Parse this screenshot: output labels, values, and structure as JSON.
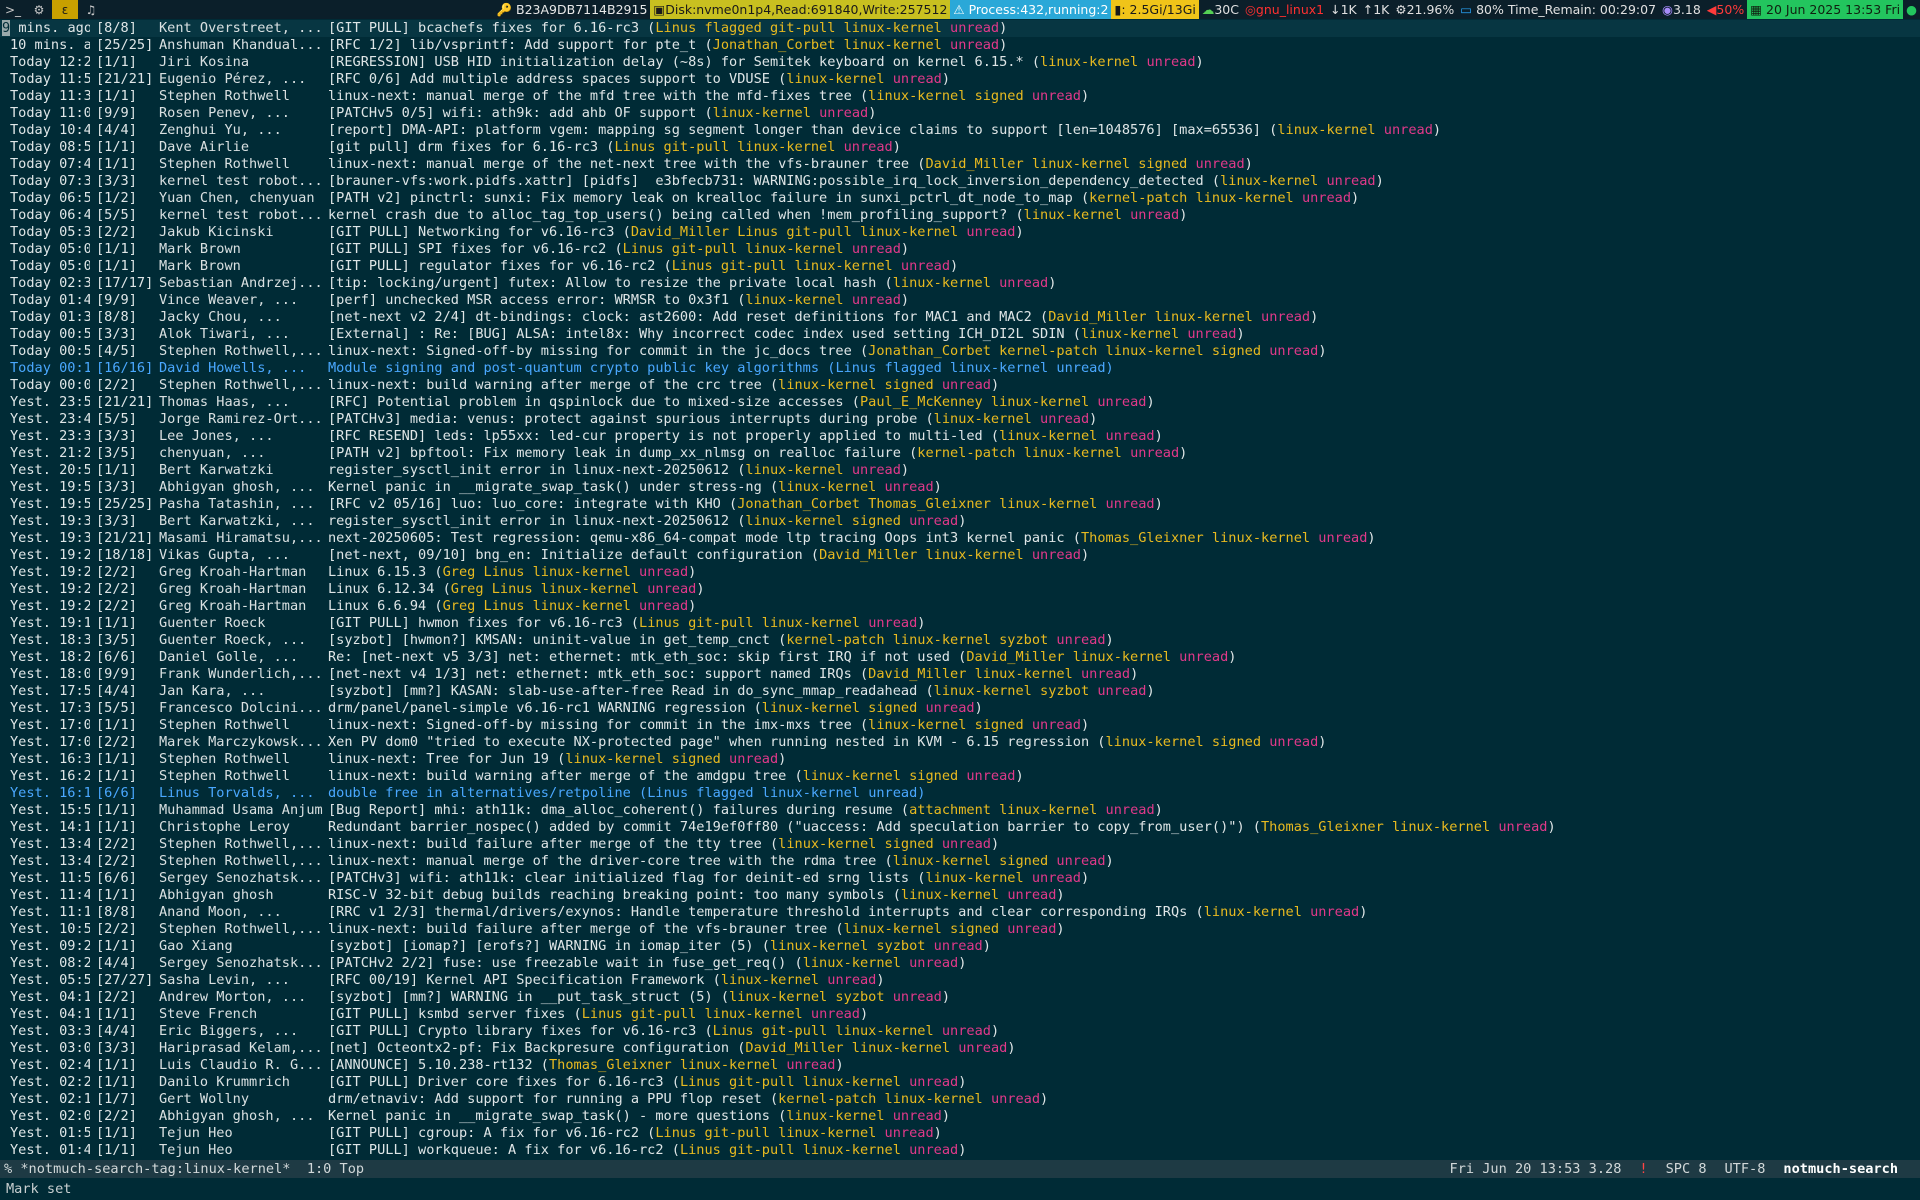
{
  "topbar": {
    "ws1_icon": "terminal-icon",
    "ws2_icon": "emacs-icon",
    "ws3_label": "ε",
    "ws4_icon": "bell-icon",
    "stream_text": "B23A9DB7114B2915",
    "disk_text": "Disk:nvme0n1p4,Read:691840,Write:257512",
    "process_text": "Process:432,running:2",
    "mem_text": ": 2.5Gi/13Gi",
    "temp_text": "30C",
    "net_text": "gnu_linux1",
    "down_text": "1K",
    "up_text": "1K",
    "cpu_text": "21.96%",
    "battery_text": "80% Time_Remain: 00:29:07",
    "load_text": "3.18",
    "volume_text": "50%",
    "date_text": "20 Jun 2025 13:53 Fri"
  },
  "colors": {
    "background": "#002b36",
    "tag": "#e8ba20",
    "unread": "#e1398a",
    "flagged": "#4aa8ff"
  },
  "rows": [
    {
      "date": "9 mins. ago",
      "count": "[8/8]",
      "author": "Kent Overstreet, ...",
      "subject": "[GIT PULL] bcachefs fixes for 6.16-rc3",
      "tags": "Linus flagged git-pull linux-kernel",
      "flag": "cur"
    },
    {
      "date": "10 mins. ago",
      "count": "[25/25]",
      "author": "Anshuman Khandual...",
      "subject": "[RFC 1/2] lib/vsprintf: Add support for pte_t",
      "tags": "Jonathan_Corbet linux-kernel"
    },
    {
      "date": "Today 12:25",
      "count": "[1/1]",
      "author": "Jiri Kosina",
      "subject": "[REGRESSION] USB HID initialization delay (~8s) for Semitek keyboard on kernel 6.15.*",
      "tags": "linux-kernel"
    },
    {
      "date": "Today 11:55",
      "count": "[21/21]",
      "author": "Eugenio Pérez, ...",
      "subject": "[RFC 0/6] Add multiple address spaces support to VDUSE",
      "tags": "linux-kernel"
    },
    {
      "date": "Today 11:33",
      "count": "[1/1]",
      "author": "Stephen Rothwell",
      "subject": "linux-next: manual merge of the mfd tree with the mfd-fixes tree",
      "tags": "linux-kernel signed"
    },
    {
      "date": "Today 11:09",
      "count": "[9/9]",
      "author": "Rosen Penev, ...",
      "subject": "[PATCHv5 0/5] wifi: ath9k: add ahb OF support",
      "tags": "linux-kernel"
    },
    {
      "date": "Today 10:47",
      "count": "[4/4]",
      "author": "Zenghui Yu, ...",
      "subject": "[report] DMA-API: platform vgem: mapping sg segment longer than device claims to support [len=1048576] [max=65536]",
      "tags": "linux-kernel"
    },
    {
      "date": "Today 08:55",
      "count": "[1/1]",
      "author": "Dave Airlie",
      "subject": "[git pull] drm fixes for 6.16-rc3",
      "tags": "Linus git-pull linux-kernel"
    },
    {
      "date": "Today 07:41",
      "count": "[1/1]",
      "author": "Stephen Rothwell",
      "subject": "linux-next: manual merge of the net-next tree with the vfs-brauner tree",
      "tags": "David_Miller linux-kernel signed"
    },
    {
      "date": "Today 07:30",
      "count": "[3/3]",
      "author": "kernel test robot...",
      "subject": "[brauner-vfs:work.pidfs.xattr] [pidfs]  e3bfecb731: WARNING:possible_irq_lock_inversion_dependency_detected",
      "tags": "linux-kernel"
    },
    {
      "date": "Today 06:57",
      "count": "[1/2]",
      "author": "Yuan Chen, chenyuan",
      "subject": "[PATH v2] pinctrl: sunxi: Fix memory leak on krealloc failure in sunxi_pctrl_dt_node_to_map",
      "tags": "kernel-patch linux-kernel"
    },
    {
      "date": "Today 06:44",
      "count": "[5/5]",
      "author": "kernel test robot...",
      "subject": "kernel crash due to alloc_tag_top_users() being called when !mem_profiling_support?",
      "tags": "linux-kernel"
    },
    {
      "date": "Today 05:30",
      "count": "[2/2]",
      "author": "Jakub Kicinski",
      "subject": "[GIT PULL] Networking for v6.16-rc3",
      "tags": "David_Miller Linus git-pull linux-kernel"
    },
    {
      "date": "Today 05:07",
      "count": "[1/1]",
      "author": "Mark Brown",
      "subject": "[GIT PULL] SPI fixes for v6.16-rc2",
      "tags": "Linus git-pull linux-kernel"
    },
    {
      "date": "Today 05:07",
      "count": "[1/1]",
      "author": "Mark Brown",
      "subject": "[GIT PULL] regulator fixes for v6.16-rc2",
      "tags": "Linus git-pull linux-kernel"
    },
    {
      "date": "Today 02:37",
      "count": "[17/17]",
      "author": "Sebastian Andrzej...",
      "subject": "[tip: locking/urgent] futex: Allow to resize the private local hash",
      "tags": "linux-kernel"
    },
    {
      "date": "Today 01:40",
      "count": "[9/9]",
      "author": "Vince Weaver, ...",
      "subject": "[perf] unchecked MSR access error: WRMSR to 0x3f1",
      "tags": "linux-kernel"
    },
    {
      "date": "Today 01:30",
      "count": "[8/8]",
      "author": "Jacky Chou, ...",
      "subject": "[net-next v2 2/4] dt-bindings: clock: ast2600: Add reset definitions for MAC1 and MAC2",
      "tags": "David_Miller linux-kernel"
    },
    {
      "date": "Today 00:56",
      "count": "[3/3]",
      "author": "Alok Tiwari, ...",
      "subject": "[External] : Re: [BUG] ALSA: intel8x: Why incorrect codec index used setting ICH_DI2L SDIN",
      "tags": "linux-kernel"
    },
    {
      "date": "Today 00:54",
      "count": "[4/5]",
      "author": "Stephen Rothwell,...",
      "subject": "linux-next: Signed-off-by missing for commit in the jc_docs tree",
      "tags": "Jonathan_Corbet kernel-patch linux-kernel signed"
    },
    {
      "date": "Today 00:19",
      "count": "[16/16]",
      "author": "David Howells, ...",
      "subject": "Module signing and post-quantum crypto public key algorithms",
      "tags": "Linus flagged linux-kernel",
      "flag": "hl"
    },
    {
      "date": "Today 00:08",
      "count": "[2/2]",
      "author": "Stephen Rothwell,...",
      "subject": "linux-next: build warning after merge of the crc tree",
      "tags": "linux-kernel signed"
    },
    {
      "date": "Yest. 23:51",
      "count": "[21/21]",
      "author": "Thomas Haas, ...",
      "subject": "[RFC] Potential problem in qspinlock due to mixed-size accesses",
      "tags": "Paul_E_McKenney linux-kernel"
    },
    {
      "date": "Yest. 23:44",
      "count": "[5/5]",
      "author": "Jorge Ramirez-Ort...",
      "subject": "[PATCHv3] media: venus: protect against spurious interrupts during probe",
      "tags": "linux-kernel"
    },
    {
      "date": "Yest. 23:32",
      "count": "[3/3]",
      "author": "Lee Jones, ...",
      "subject": "[RFC RESEND] leds: lp55xx: led-cur property is not properly applied to multi-led",
      "tags": "linux-kernel"
    },
    {
      "date": "Yest. 21:25",
      "count": "[3/5]",
      "author": "chenyuan, ...",
      "subject": "[PATH v2] bpftool: Fix memory leak in dump_xx_nlmsg on realloc failure",
      "tags": "kernel-patch linux-kernel"
    },
    {
      "date": "Yest. 20:52",
      "count": "[1/1]",
      "author": "Bert Karwatzki",
      "subject": "register_sysctl_init error in linux-next-20250612",
      "tags": "linux-kernel"
    },
    {
      "date": "Yest. 19:53",
      "count": "[3/3]",
      "author": "Abhigyan ghosh, ...",
      "subject": "Kernel panic in __migrate_swap_task() under stress-ng",
      "tags": "linux-kernel"
    },
    {
      "date": "Yest. 19:52",
      "count": "[25/25]",
      "author": "Pasha Tatashin, ...",
      "subject": "[RFC v2 05/16] luo: luo_core: integrate with KHO",
      "tags": "Jonathan_Corbet Thomas_Gleixner linux-kernel"
    },
    {
      "date": "Yest. 19:39",
      "count": "[3/3]",
      "author": "Bert Karwatzki, ...",
      "subject": "register_sysctl_init error in linux-next-20250612",
      "tags": "linux-kernel signed"
    },
    {
      "date": "Yest. 19:30",
      "count": "[21/21]",
      "author": "Masami Hiramatsu,...",
      "subject": "next-20250605: Test regression: qemu-x86_64-compat mode ltp tracing Oops int3 kernel panic",
      "tags": "Thomas_Gleixner linux-kernel"
    },
    {
      "date": "Yest. 19:27",
      "count": "[18/18]",
      "author": "Vikas Gupta, ...",
      "subject": "[net-next, 09/10] bng_en: Initialize default configuration",
      "tags": "David_Miller linux-kernel"
    },
    {
      "date": "Yest. 19:20",
      "count": "[2/2]",
      "author": "Greg Kroah-Hartman",
      "subject": "Linux 6.15.3",
      "tags": "Greg Linus linux-kernel"
    },
    {
      "date": "Yest. 19:20",
      "count": "[2/2]",
      "author": "Greg Kroah-Hartman",
      "subject": "Linux 6.12.34",
      "tags": "Greg Linus linux-kernel"
    },
    {
      "date": "Yest. 19:20",
      "count": "[2/2]",
      "author": "Greg Kroah-Hartman",
      "subject": "Linux 6.6.94",
      "tags": "Greg Linus linux-kernel"
    },
    {
      "date": "Yest. 19:16",
      "count": "[1/1]",
      "author": "Guenter Roeck",
      "subject": "[GIT PULL] hwmon fixes for v6.16-rc3",
      "tags": "Linus git-pull linux-kernel"
    },
    {
      "date": "Yest. 18:31",
      "count": "[3/5]",
      "author": "Guenter Roeck, ...",
      "subject": "[syzbot] [hwmon?] KMSAN: uninit-value in get_temp_cnct",
      "tags": "kernel-patch linux-kernel syzbot"
    },
    {
      "date": "Yest. 18:21",
      "count": "[6/6]",
      "author": "Daniel Golle, ...",
      "subject": "Re: [net-next v5 3/3] net: ethernet: mtk_eth_soc: skip first IRQ if not used",
      "tags": "David_Miller linux-kernel"
    },
    {
      "date": "Yest. 18:08",
      "count": "[9/9]",
      "author": "Frank Wunderlich,...",
      "subject": "[net-next v4 1/3] net: ethernet: mtk_eth_soc: support named IRQs",
      "tags": "David_Miller linux-kernel"
    },
    {
      "date": "Yest. 17:59",
      "count": "[4/4]",
      "author": "Jan Kara, ...",
      "subject": "[syzbot] [mm?] KASAN: slab-use-after-free Read in do_sync_mmap_readahead",
      "tags": "linux-kernel syzbot"
    },
    {
      "date": "Yest. 17:37",
      "count": "[5/5]",
      "author": "Francesco Dolcini...",
      "subject": "drm/panel/panel-simple v6.16-rc1 WARNING regression",
      "tags": "linux-kernel signed"
    },
    {
      "date": "Yest. 17:03",
      "count": "[1/1]",
      "author": "Stephen Rothwell",
      "subject": "linux-next: Signed-off-by missing for commit in the imx-mxs tree",
      "tags": "linux-kernel signed"
    },
    {
      "date": "Yest. 17:01",
      "count": "[2/2]",
      "author": "Marek Marczykowsk...",
      "subject": "Xen PV dom0 \"tried to execute NX-protected page\" when running nested in KVM - 6.15 regression",
      "tags": "linux-kernel signed"
    },
    {
      "date": "Yest. 16:33",
      "count": "[1/1]",
      "author": "Stephen Rothwell",
      "subject": "linux-next: Tree for Jun 19",
      "tags": "linux-kernel signed"
    },
    {
      "date": "Yest. 16:29",
      "count": "[1/1]",
      "author": "Stephen Rothwell",
      "subject": "linux-next: build warning after merge of the amdgpu tree",
      "tags": "linux-kernel signed"
    },
    {
      "date": "Yest. 16:19",
      "count": "[6/6]",
      "author": "Linus Torvalds, ...",
      "subject": "double free in alternatives/retpoline",
      "tags": "Linus flagged linux-kernel",
      "flag": "hl"
    },
    {
      "date": "Yest. 15:57",
      "count": "[1/1]",
      "author": "Muhammad Usama Anjum",
      "subject": "[Bug Report] mhi: ath11k: dma_alloc_coherent() failures during resume",
      "tags": "attachment linux-kernel"
    },
    {
      "date": "Yest. 14:12",
      "count": "[1/1]",
      "author": "Christophe Leroy",
      "subject": "Redundant barrier_nospec() added by commit 74e19ef0ff80 (\"uaccess: Add speculation barrier to copy_from_user()\")",
      "tags": "Thomas_Gleixner linux-kernel"
    },
    {
      "date": "Yest. 13:49",
      "count": "[2/2]",
      "author": "Stephen Rothwell,...",
      "subject": "linux-next: build failure after merge of the tty tree",
      "tags": "linux-kernel signed"
    },
    {
      "date": "Yest. 13:48",
      "count": "[2/2]",
      "author": "Stephen Rothwell,...",
      "subject": "linux-next: manual merge of the driver-core tree with the rdma tree",
      "tags": "linux-kernel signed"
    },
    {
      "date": "Yest. 11:50",
      "count": "[6/6]",
      "author": "Sergey Senozhatsk...",
      "subject": "[PATCHv3] wifi: ath11k: clear initialized flag for deinit-ed srng lists",
      "tags": "linux-kernel"
    },
    {
      "date": "Yest. 11:41",
      "count": "[1/1]",
      "author": "Abhigyan ghosh",
      "subject": "RISC-V 32-bit debug builds reaching breaking point: too many symbols",
      "tags": "linux-kernel"
    },
    {
      "date": "Yest. 11:15",
      "count": "[8/8]",
      "author": "Anand Moon, ...",
      "subject": "[RRC v1 2/3] thermal/drivers/exynos: Handle temperature threshold interrupts and clear corresponding IRQs",
      "tags": "linux-kernel"
    },
    {
      "date": "Yest. 10:52",
      "count": "[2/2]",
      "author": "Stephen Rothwell,...",
      "subject": "linux-next: build failure after merge of the vfs-brauner tree",
      "tags": "linux-kernel signed"
    },
    {
      "date": "Yest. 09:23",
      "count": "[1/1]",
      "author": "Gao Xiang",
      "subject": "[syzbot] [iomap?] [erofs?] WARNING in iomap_iter (5)",
      "tags": "linux-kernel syzbot"
    },
    {
      "date": "Yest. 08:21",
      "count": "[4/4]",
      "author": "Sergey Senozhatsk...",
      "subject": "[PATCHv2 2/2] fuse: use freezable wait in fuse_get_req()",
      "tags": "linux-kernel"
    },
    {
      "date": "Yest. 05:52",
      "count": "[27/27]",
      "author": "Sasha Levin, ...",
      "subject": "[RFC 00/19] Kernel API Specification Framework",
      "tags": "linux-kernel"
    },
    {
      "date": "Yest. 04:19",
      "count": "[2/2]",
      "author": "Andrew Morton, ...",
      "subject": "[syzbot] [mm?] WARNING in __put_task_struct (5)",
      "tags": "linux-kernel syzbot"
    },
    {
      "date": "Yest. 04:16",
      "count": "[1/1]",
      "author": "Steve French",
      "subject": "[GIT PULL] ksmbd server fixes",
      "tags": "Linus git-pull linux-kernel"
    },
    {
      "date": "Yest. 03:35",
      "count": "[4/4]",
      "author": "Eric Biggers, ...",
      "subject": "[GIT PULL] Crypto library fixes for v6.16-rc3",
      "tags": "Linus git-pull linux-kernel"
    },
    {
      "date": "Yest. 03:00",
      "count": "[3/3]",
      "author": "Hariprasad Kelam,...",
      "subject": "[net] Octeontx2-pf: Fix Backpresure configuration",
      "tags": "David_Miller linux-kernel"
    },
    {
      "date": "Yest. 02:41",
      "count": "[1/1]",
      "author": "Luis Claudio R. G...",
      "subject": "[ANNOUNCE] 5.10.238-rt132",
      "tags": "Thomas_Gleixner linux-kernel"
    },
    {
      "date": "Yest. 02:26",
      "count": "[1/1]",
      "author": "Danilo Krummrich",
      "subject": "[GIT PULL] Driver core fixes for 6.16-rc3",
      "tags": "Linus git-pull linux-kernel"
    },
    {
      "date": "Yest. 02:13",
      "count": "[1/7]",
      "author": "Gert Wollny",
      "subject": "drm/etnaviv: Add support for running a PPU flop reset",
      "tags": "kernel-patch linux-kernel"
    },
    {
      "date": "Yest. 02:07",
      "count": "[2/2]",
      "author": "Abhigyan ghosh, ...",
      "subject": "Kernel panic in __migrate_swap_task() - more questions",
      "tags": "linux-kernel"
    },
    {
      "date": "Yest. 01:53",
      "count": "[1/1]",
      "author": "Tejun Heo",
      "subject": "[GIT PULL] cgroup: A fix for v6.16-rc2",
      "tags": "Linus git-pull linux-kernel"
    },
    {
      "date": "Yest. 01:49",
      "count": "[1/1]",
      "author": "Tejun Heo",
      "subject": "[GIT PULL] workqueue: A fix for v6.16-rc2",
      "tags": "Linus git-pull linux-kernel"
    }
  ],
  "unread_label": "unread",
  "modeline": {
    "left": "% *notmuch-search-tag:linux-kernel*  1:0 Top",
    "datetime": "Fri Jun 20 13:53 3.28",
    "bang": "!",
    "spc": "SPC 8",
    "encoding": "UTF-8",
    "mode": "notmuch-search"
  },
  "minibuffer": "Mark set"
}
